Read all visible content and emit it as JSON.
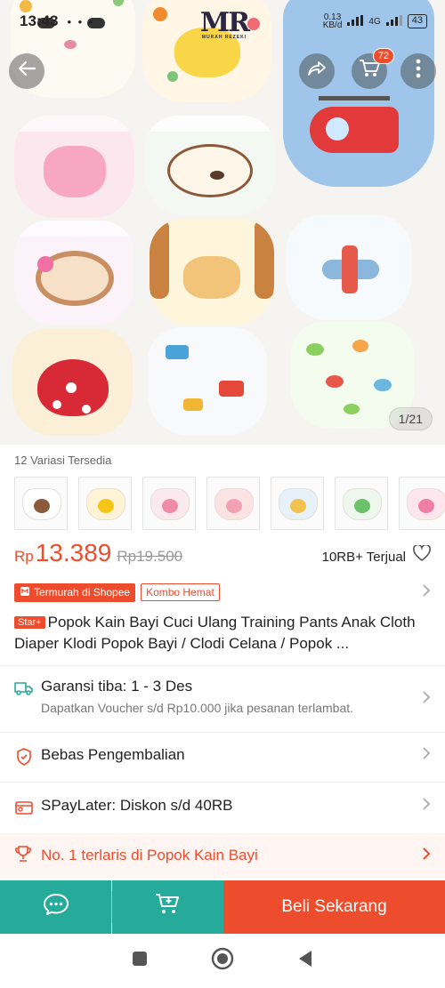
{
  "status_bar": {
    "time": "13:43",
    "sys_icons": "• • •",
    "net_speed_top": "0.13",
    "net_speed_unit": "KB/d",
    "network": "4G",
    "battery": "43"
  },
  "hero": {
    "brand_logo": "MR",
    "brand_sub": "MURAH REZEKI",
    "cart_count": "72",
    "image_counter": "1/21",
    "icons": {
      "back": "back-arrow-icon",
      "share": "share-icon",
      "cart": "cart-icon",
      "more": "more-vertical-icon"
    }
  },
  "variants": {
    "label": "12 Variasi Tersedia",
    "thumbs": [
      {
        "name": "dog",
        "color": "#ffffff",
        "accent": "#8a5a3a"
      },
      {
        "name": "duck",
        "color": "#fff3d6",
        "accent": "#f5c518"
      },
      {
        "name": "cupcake",
        "color": "#fbe9ef",
        "accent": "#f08aa8"
      },
      {
        "name": "bunny",
        "color": "#fbe3e3",
        "accent": "#f2a1b0"
      },
      {
        "name": "giraffe",
        "color": "#e7f1fa",
        "accent": "#f2c14e"
      },
      {
        "name": "frog",
        "color": "#eef7ee",
        "accent": "#6cc26a"
      },
      {
        "name": "pig",
        "color": "#fde6ee",
        "accent": "#ef7fa4"
      }
    ]
  },
  "price": {
    "currency": "Rp",
    "current": "13.389",
    "original": "Rp19.500",
    "sold": "10RB+ Terjual"
  },
  "tags": {
    "main": "Termurah di Shopee",
    "outline": "Kombo Hemat"
  },
  "product": {
    "badge": "Star+",
    "title": "Popok Kain Bayi Cuci Ulang Training Pants Anak Cloth Diaper Klodi Popok Bayi / Clodi Celana / Popok ..."
  },
  "info": {
    "shipping_main": "Garansi tiba: 1 - 3 Des",
    "shipping_sub": "Dapatkan Voucher s/d Rp10.000 jika pesanan terlambat.",
    "returns": "Bebas Pengembalian",
    "paylater": "SPayLater: Diskon s/d 40RB",
    "bestseller": "No. 1 terlaris di Popok Kain Bayi"
  },
  "actions": {
    "buy_now": "Beli Sekarang"
  },
  "colors": {
    "brand": "#ee4d2d",
    "teal": "#26aa99",
    "promo_bg": "#fff5f3"
  }
}
